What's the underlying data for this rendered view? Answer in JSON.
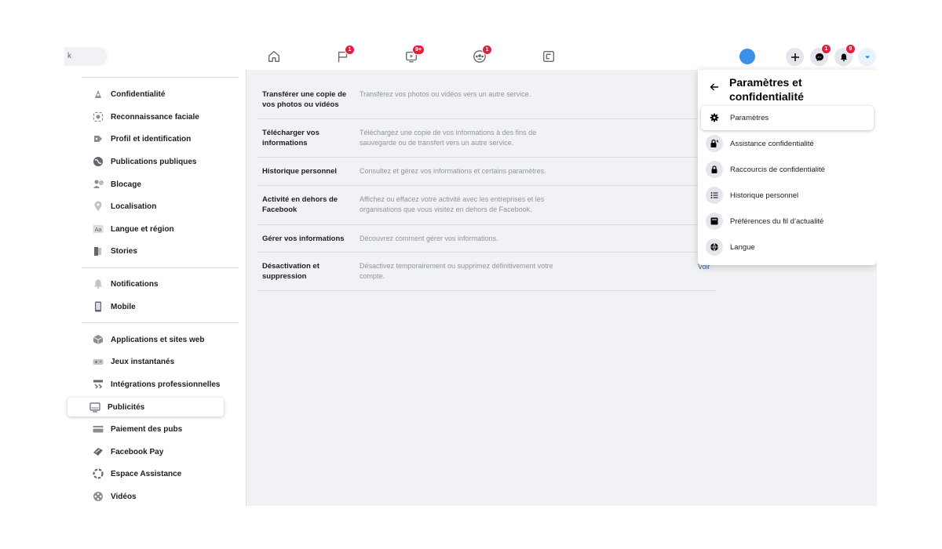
{
  "topbar": {
    "search_text": "k",
    "nav": [
      {
        "icon": "home-icon",
        "badge": ""
      },
      {
        "icon": "pages-flag-icon",
        "badge": "1"
      },
      {
        "icon": "watch-video-icon",
        "badge": "9+"
      },
      {
        "icon": "groups-icon",
        "badge": "1"
      },
      {
        "icon": "gaming-icon",
        "badge": ""
      }
    ],
    "messenger_badge": "1",
    "notifications_badge": "9"
  },
  "sidebar": {
    "items": [
      {
        "label": "Confidentialité",
        "icon": "lock-person-icon"
      },
      {
        "label": "Reconnaissance faciale",
        "icon": "face-icon"
      },
      {
        "label": "Profil et identification",
        "icon": "tag-icon"
      },
      {
        "label": "Publications publiques",
        "icon": "globe-icon"
      },
      {
        "label": "Blocage",
        "icon": "block-user-icon"
      },
      {
        "label": "Localisation",
        "icon": "location-pin-icon"
      },
      {
        "label": "Langue et région",
        "icon": "language-aa-icon"
      },
      {
        "label": "Stories",
        "icon": "book-icon"
      },
      {
        "label": "Notifications",
        "icon": "bell-icon"
      },
      {
        "label": "Mobile",
        "icon": "mobile-icon"
      },
      {
        "label": "Applications et sites web",
        "icon": "cube-icon"
      },
      {
        "label": "Jeux instantanés",
        "icon": "gamepad-icon"
      },
      {
        "label": "Intégrations professionnelles",
        "icon": "briefcase-integration-icon"
      },
      {
        "label": "Publicités",
        "icon": "ads-monitor-icon"
      },
      {
        "label": "Paiement des pubs",
        "icon": "credit-card-icon"
      },
      {
        "label": "Facebook Pay",
        "icon": "pay-tag-icon"
      },
      {
        "label": "Espace Assistance",
        "icon": "lifebuoy-icon"
      },
      {
        "label": "Vidéos",
        "icon": "film-reel-icon"
      }
    ],
    "active": "Publicités"
  },
  "content": {
    "rows": [
      {
        "title": "Transférer une copie de vos photos ou vidéos",
        "desc": "Transférez vos photos ou vidéos vers un autre service."
      },
      {
        "title": "Télécharger vos informations",
        "desc": "Téléchargez une copie de vos informations à des fins de sauvegarde ou de transfert vers un autre service."
      },
      {
        "title": "Historique personnel",
        "desc": "Consultez et gérez vos informations et certains paramètres."
      },
      {
        "title": "Activité en dehors de Facebook",
        "desc": "Affichez ou effacez votre activité avec les entreprises et les organisations que vous visitez en dehors de Facebook."
      },
      {
        "title": "Gérer vos informations",
        "desc": "Découvrez comment gérer vos informations."
      },
      {
        "title": "Désactivation et suppression",
        "desc": "Désactivez temporairement ou supprimez définitivement votre compte."
      }
    ],
    "voir_label": "Voir"
  },
  "menu": {
    "title": "Paramètres et confidentialité",
    "items": [
      {
        "label": "Paramètres",
        "icon": "gear-icon"
      },
      {
        "label": "Assistance confidentialité",
        "icon": "lock-key-icon"
      },
      {
        "label": "Raccourcis de confidentialité",
        "icon": "lock-icon"
      },
      {
        "label": "Historique personnel",
        "icon": "list-icon"
      },
      {
        "label": "Préférences du fil d’actualité",
        "icon": "news-feed-icon"
      },
      {
        "label": "Langue",
        "icon": "globe-icon"
      }
    ]
  },
  "colors": {
    "accent": "#1877f2",
    "badge": "#e41e3f",
    "avatar": "#3b8fea"
  }
}
